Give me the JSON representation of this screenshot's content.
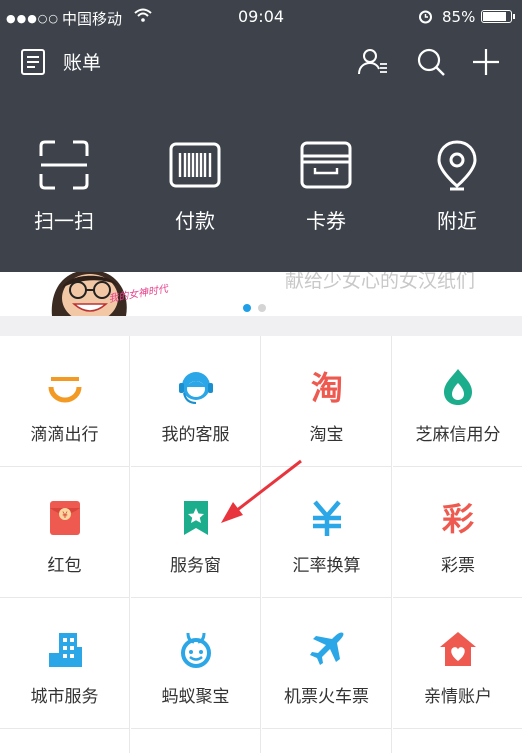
{
  "status_bar": {
    "signal": "●●●○○",
    "carrier": "中国移动",
    "time": "09:04",
    "battery": "85%"
  },
  "header": {
    "bill_label": "账单",
    "icons": [
      "bill-icon",
      "contacts-icon",
      "search-icon",
      "add-icon"
    ]
  },
  "quick_actions": [
    {
      "label": "扫一扫",
      "icon": "scan-icon"
    },
    {
      "label": "付款",
      "icon": "barcode-icon"
    },
    {
      "label": "卡券",
      "icon": "card-icon"
    },
    {
      "label": "附近",
      "icon": "location-icon"
    }
  ],
  "banner": {
    "tag": "我的女神时代",
    "slogan": "献给少女心的女汉纸们",
    "page_count": 2,
    "active_page": 1
  },
  "apps": [
    {
      "label": "滴滴出行",
      "icon": "didi-icon"
    },
    {
      "label": "我的客服",
      "icon": "customer-service-icon"
    },
    {
      "label": "淘宝",
      "icon": "taobao-icon",
      "glyph": "淘"
    },
    {
      "label": "芝麻信用分",
      "icon": "sesame-credit-icon"
    },
    {
      "label": "红包",
      "icon": "red-packet-icon",
      "glyph": "¥"
    },
    {
      "label": "服务窗",
      "icon": "service-window-icon"
    },
    {
      "label": "汇率换算",
      "icon": "exchange-rate-icon"
    },
    {
      "label": "彩票",
      "icon": "lottery-icon",
      "glyph": "彩"
    },
    {
      "label": "城市服务",
      "icon": "city-service-icon"
    },
    {
      "label": "蚂蚁聚宝",
      "icon": "ant-fortune-icon"
    },
    {
      "label": "机票火车票",
      "icon": "flight-train-icon"
    },
    {
      "label": "亲情账户",
      "icon": "family-account-icon"
    }
  ],
  "colors": {
    "header_bg": "#3e434b",
    "dot_active": "#1e9fe8",
    "dot_inactive": "#d4d4d4",
    "annotation_arrow": "#e8343d"
  }
}
